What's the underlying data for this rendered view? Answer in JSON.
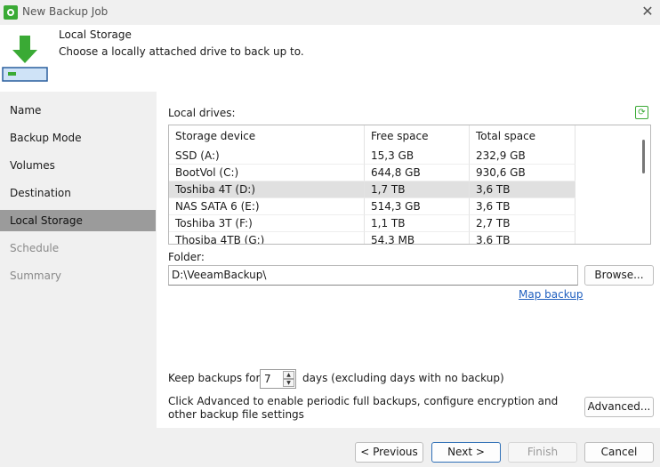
{
  "window": {
    "title": "New Backup Job",
    "close_glyph": "✕"
  },
  "header": {
    "title": "Local Storage",
    "subtitle": "Choose a locally attached drive to back up to."
  },
  "nav": {
    "items": [
      {
        "label": "Name",
        "state": "normal"
      },
      {
        "label": "Backup Mode",
        "state": "normal"
      },
      {
        "label": "Volumes",
        "state": "normal"
      },
      {
        "label": "Destination",
        "state": "normal"
      },
      {
        "label": "Local Storage",
        "state": "active"
      },
      {
        "label": "Schedule",
        "state": "disabled"
      },
      {
        "label": "Summary",
        "state": "disabled"
      }
    ]
  },
  "drives": {
    "label": "Local drives:",
    "columns": [
      "Storage device",
      "Free space",
      "Total space"
    ],
    "rows": [
      {
        "device": "SSD (A:)",
        "free": "15,3 GB",
        "total": "232,9 GB",
        "selected": false
      },
      {
        "device": "BootVol (C:)",
        "free": "644,8 GB",
        "total": "930,6 GB",
        "selected": false
      },
      {
        "device": "Toshiba 4T (D:)",
        "free": "1,7 TB",
        "total": "3,6 TB",
        "selected": true
      },
      {
        "device": "NAS SATA 6 (E:)",
        "free": "514,3 GB",
        "total": "3,6 TB",
        "selected": false
      },
      {
        "device": "Toshiba 3T (F:)",
        "free": "1,1 TB",
        "total": "2,7 TB",
        "selected": false
      },
      {
        "device": "Thosiba 4TB (G:)",
        "free": "54,3 MB",
        "total": "3,6 TB",
        "selected": false
      }
    ]
  },
  "folder": {
    "label": "Folder:",
    "value": "D:\\VeeamBackup\\",
    "browse_label": "Browse...",
    "map_backup_label": "Map backup"
  },
  "retention": {
    "label_before": "Keep backups for:",
    "value": "7",
    "label_after": "days (excluding days with no backup)"
  },
  "advanced": {
    "text": "Click Advanced to enable periodic full backups, configure encryption and other backup file settings",
    "button_label": "Advanced..."
  },
  "footer": {
    "previous_label": "< Previous",
    "next_label": "Next >",
    "finish_label": "Finish",
    "cancel_label": "Cancel"
  },
  "colors": {
    "accent_green": "#3aaa35",
    "selection_nav": "#9b9b9b",
    "link": "#1f5fbf",
    "primary_border": "#2f6fb6"
  }
}
